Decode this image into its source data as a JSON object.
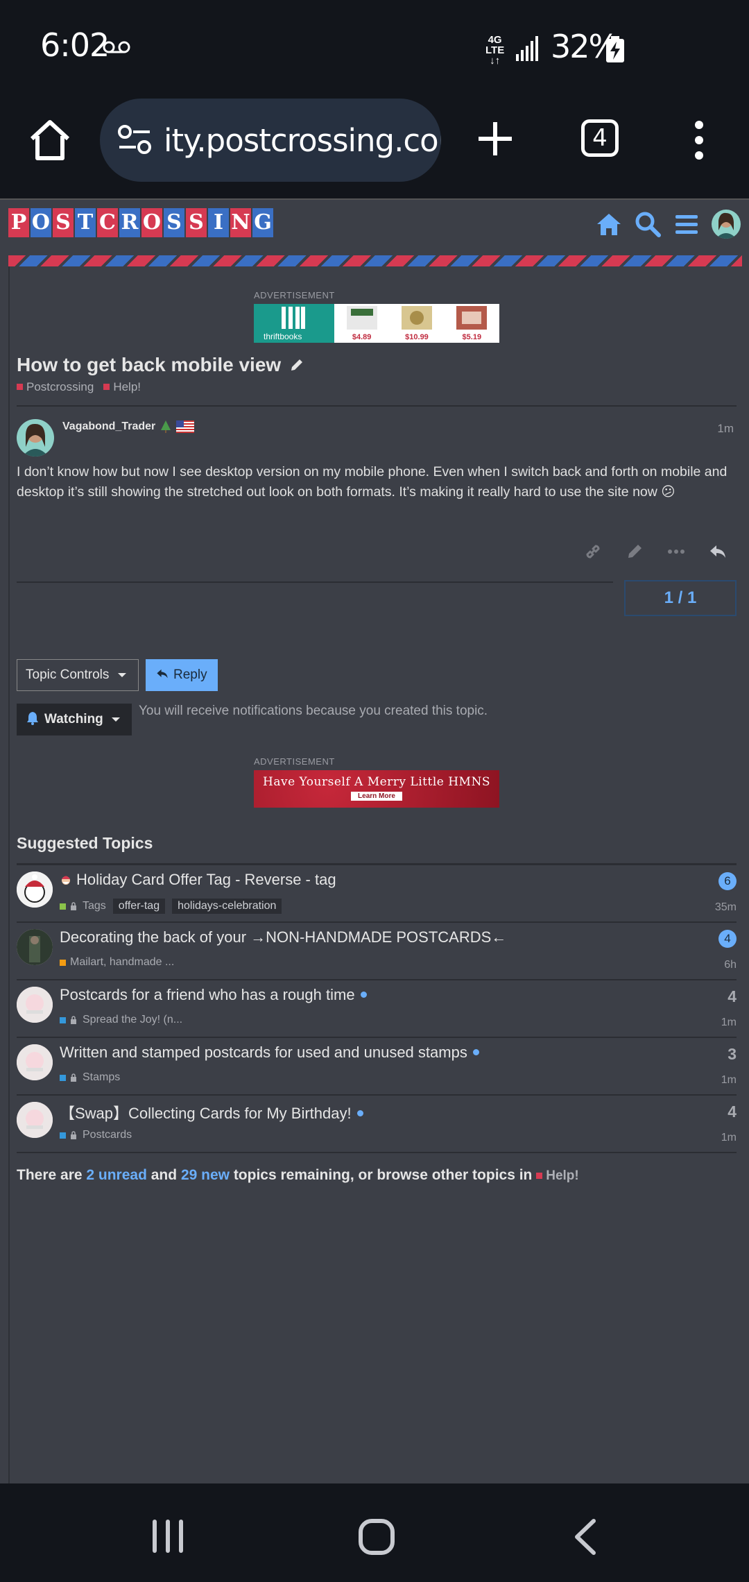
{
  "status_bar": {
    "time": "6:02",
    "network": "4G LTE",
    "battery": "32%"
  },
  "browser": {
    "url": "ity.postcrossing.com",
    "tab_count": "4"
  },
  "site": {
    "logo_letters": [
      "P",
      "O",
      "S",
      "T",
      "C",
      "R",
      "O",
      "S",
      "S",
      "I",
      "N",
      "G"
    ]
  },
  "ads": {
    "label": "ADVERTISEMENT",
    "ad1_brand": "thriftbooks",
    "ad1_prices": [
      "$4.89",
      "$10.99",
      "$5.19"
    ],
    "ad2_headline": "Have Yourself A Merry Little HMNS",
    "ad2_cta": "Learn More"
  },
  "topic": {
    "title": "How to get back mobile view",
    "categories": [
      "Postcrossing",
      "Help!"
    ]
  },
  "post": {
    "username": "Vagabond_Trader",
    "time": "1m",
    "body": "I don’t know how but now I see desktop version on my mobile phone. Even when I switch back and forth on mobile and desktop it’s still showing the stretched out look on both formats. It’s making it really hard to use the site now 😕"
  },
  "timeline": {
    "position": "1 / 1"
  },
  "controls": {
    "topic_controls": "Topic Controls",
    "reply": "Reply",
    "watching": "Watching",
    "notification_text": "You will receive notifications because you created this topic."
  },
  "suggested": {
    "title": "Suggested Topics",
    "topics": [
      {
        "title": "Holiday Card Offer Tag - Reverse - tag",
        "category": "Tags",
        "category_color": "#8bc34a",
        "tags": [
          "offer-tag",
          "holidays-celebration"
        ],
        "badge": "6",
        "age": "35m"
      },
      {
        "title": "Decorating the back of your →NON-HANDMADE POSTCARDS←",
        "category": "Mailart, handmade ...",
        "category_color": "#f39c12",
        "badge": "4",
        "age": "6h"
      },
      {
        "title": "Postcards for a friend who has a rough time",
        "category": "Spread the Joy! (n...",
        "category_color": "#3498db",
        "count": "4",
        "age": "1m"
      },
      {
        "title": "Written and stamped postcards for used and unused stamps",
        "category": "Stamps",
        "category_color": "#3498db",
        "count": "3",
        "age": "1m"
      },
      {
        "title": "【Swap】Collecting Cards for My Birthday!",
        "category": "Postcards",
        "category_color": "#3498db",
        "count": "4",
        "age": "1m"
      }
    ]
  },
  "footer_text": {
    "prefix": "There are ",
    "unread": "2 unread",
    "mid": " and ",
    "new": "29 new",
    "suffix": " topics remaining, or browse other topics in ",
    "category": "Help!"
  }
}
